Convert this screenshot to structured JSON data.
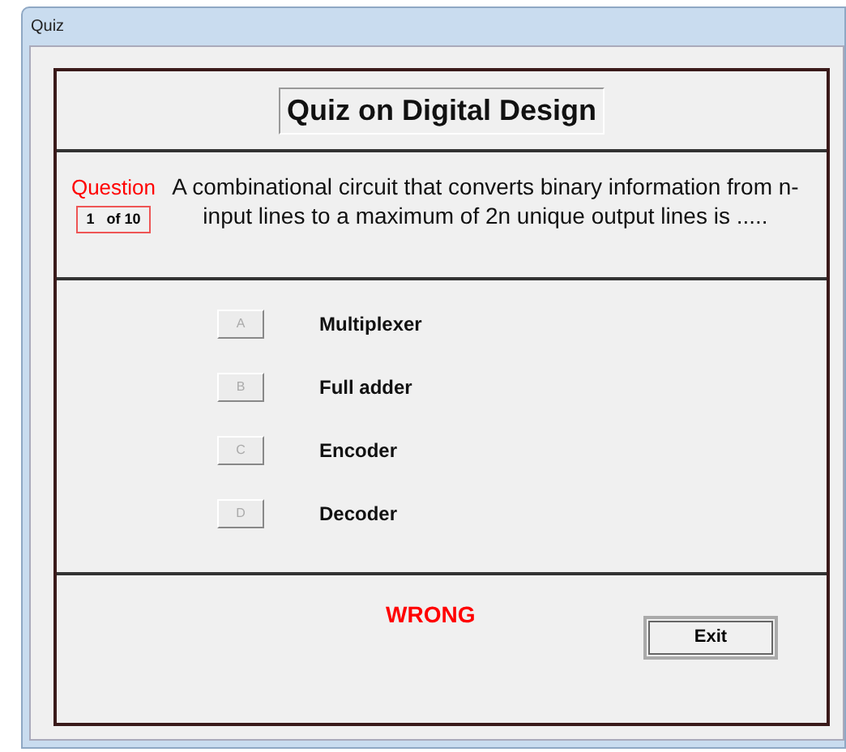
{
  "window": {
    "title": "Quiz"
  },
  "quiz_title": "Quiz on Digital Design",
  "question": {
    "label": "Question",
    "counter": "1   of 10",
    "text": "A combinational circuit that converts binary information from n- input lines to a maximum of 2n unique output lines is ....."
  },
  "options": [
    {
      "letter": "A",
      "text": "Multiplexer",
      "disabled": true
    },
    {
      "letter": "B",
      "text": "Full adder",
      "disabled": true
    },
    {
      "letter": "C",
      "text": "Encoder",
      "disabled": true
    },
    {
      "letter": "D",
      "text": "Decoder",
      "disabled": true
    }
  ],
  "result": "WRONG",
  "buttons": [
    {
      "label": "Exit"
    }
  ]
}
